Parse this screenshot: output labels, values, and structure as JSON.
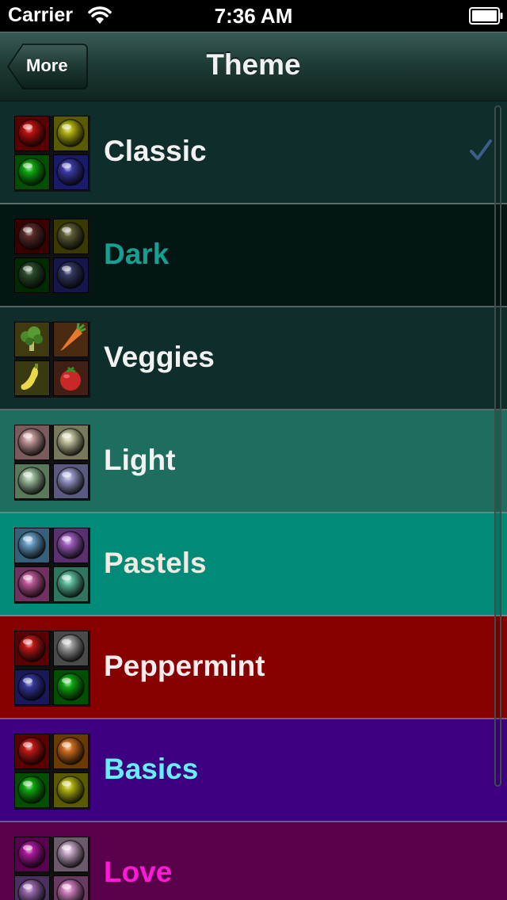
{
  "status_bar": {
    "carrier": "Carrier",
    "time": "7:36 AM"
  },
  "nav": {
    "back_label": "More",
    "title": "Theme"
  },
  "themes": [
    {
      "label": "Classic",
      "selected": true,
      "bg": "#0f2d2a",
      "text_color": "#f2f2f2",
      "tiles": [
        "#bf1010",
        "#b4b414",
        "#12aa12",
        "#3c3ca8"
      ],
      "tile_bg": [
        "#5a0000",
        "#5a5a00",
        "#005000",
        "#1a1a6a"
      ]
    },
    {
      "label": "Dark",
      "selected": false,
      "bg": "#031614",
      "text_color": "#16a094",
      "tiles": [
        "#5e2c2c",
        "#616037",
        "#2d4d2d",
        "#373a66"
      ],
      "tile_bg": [
        "#3a0000",
        "#3a3a00",
        "#002a00",
        "#16164a"
      ]
    },
    {
      "label": "Veggies",
      "selected": false,
      "bg": "#0f2d2a",
      "text_color": "#f2f2f2",
      "tiles": [
        "broccoli-icon",
        "carrot-icon",
        "squash-icon",
        "tomato-icon"
      ],
      "tile_bg": [
        "#3f3a10",
        "#4a2a10",
        "#3a3a12",
        "#402014"
      ]
    },
    {
      "label": "Light",
      "selected": false,
      "bg": "#1e6e60",
      "text_color": "#f2f2f2",
      "tiles": [
        "#c79a9a",
        "#c7c7a0",
        "#9fc09f",
        "#9b9bcc"
      ],
      "tile_bg": [
        "#7a5a5a",
        "#78785a",
        "#5a785a",
        "#5a5a80"
      ]
    },
    {
      "label": "Pastels",
      "selected": false,
      "bg": "#008a78",
      "text_color": "#f1eae0",
      "tiles": [
        "#6aa0c8",
        "#a060c0",
        "#c05a9a",
        "#60c0a0"
      ],
      "tile_bg": [
        "#35607a",
        "#5a3070",
        "#703060",
        "#307560"
      ]
    },
    {
      "label": "Peppermint",
      "selected": false,
      "bg": "#860000",
      "text_color": "#f4eeee",
      "tiles": [
        "#c01818",
        "#a0a0a0",
        "#3838a0",
        "#12aa12"
      ],
      "tile_bg": [
        "#5a0000",
        "#4a4a4a",
        "#18185a",
        "#005000"
      ]
    },
    {
      "label": "Basics",
      "selected": false,
      "bg": "#3c0080",
      "text_color": "#66f0ff",
      "tiles": [
        "#c01818",
        "#d07020",
        "#12aa12",
        "#b4b414"
      ],
      "tile_bg": [
        "#5a0000",
        "#6a3a00",
        "#005000",
        "#5a5a00"
      ]
    },
    {
      "label": "Love",
      "selected": false,
      "bg": "#58004a",
      "text_color": "#ff18d8",
      "tiles": [
        "#b01aa0",
        "#c8a8c8",
        "#9a6ab0",
        "#d080c0"
      ],
      "tile_bg": [
        "#5a0050",
        "#6a5a6a",
        "#4a3060",
        "#6a3a60"
      ]
    }
  ],
  "colors": {
    "checkmark": "#3d5e88",
    "nav_title": "#f1f1f1"
  }
}
